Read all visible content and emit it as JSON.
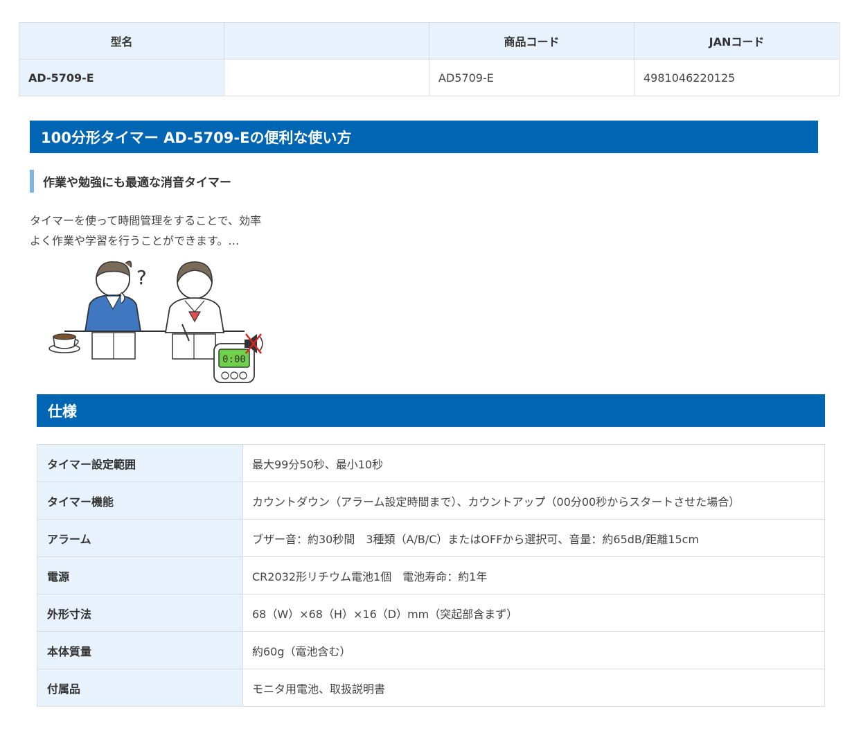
{
  "product_table": {
    "headers": [
      "型名",
      "",
      "商品コード",
      "JANコード"
    ],
    "row": [
      "AD-5709-E",
      "",
      "AD5709-E",
      "4981046220125"
    ]
  },
  "usage": {
    "title": "100分形タイマー AD-5709-Eの便利な使い方",
    "subheading": "作業や勉強にも最適な消音タイマー",
    "body_line1": "タイマーを使って時間管理をすることで、効率",
    "body_line2": "よく作業や学習を行うことができます。…",
    "timer_display": "0:00"
  },
  "spec": {
    "title": "仕様",
    "rows": [
      {
        "label": "タイマー設定範囲",
        "value": "最大99分50秒、最小10秒"
      },
      {
        "label": "タイマー機能",
        "value": "カウントダウン（アラーム設定時間まで）、カウントアップ（00分00秒からスタートさせた場合）"
      },
      {
        "label": "アラーム",
        "value": "ブザー音：約30秒間　3種類（A/B/C）またはOFFから選択可、音量：約65dB/距離15cm"
      },
      {
        "label": "電源",
        "value": "CR2032形リチウム電池1個　電池寿命：約1年"
      },
      {
        "label": "外形寸法",
        "value": "68（W）×68（H）×16（D）mm（突起部含まず）"
      },
      {
        "label": "本体質量",
        "value": "約60g（電池含む）"
      },
      {
        "label": "付属品",
        "value": "モニタ用電池、取扱説明書"
      }
    ]
  },
  "colors": {
    "header_blue": "#0066b3",
    "cell_bg": "#e8f2fc",
    "accent_bar": "#7bb7e6",
    "timer_green": "#6fd14a"
  }
}
